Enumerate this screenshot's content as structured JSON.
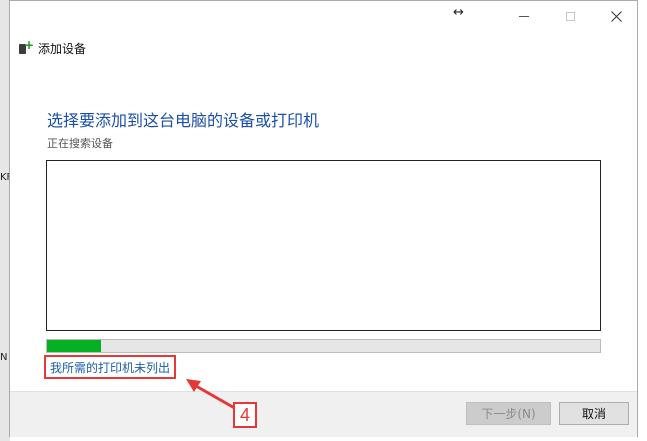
{
  "window": {
    "title": "添加设备"
  },
  "main": {
    "heading": "选择要添加到这台电脑的设备或打印机",
    "status": "正在搜索设备",
    "progress_fraction": 0.097
  },
  "link": {
    "printer_not_listed": "我所需的打印机未列出"
  },
  "annotation": {
    "step_number": "4",
    "color": "#e53935"
  },
  "footer": {
    "next_label": "下一步(N)",
    "cancel_label": "取消"
  },
  "background": {
    "fragments": [
      "KF",
      "N"
    ]
  },
  "icons": {
    "app": "add-device-icon",
    "resize": "resize-horizontal-icon",
    "minimize": "minimize-icon",
    "maximize": "maximize-icon",
    "close": "close-icon"
  },
  "colors": {
    "heading": "#1b4fa8",
    "link": "#1b5ea8",
    "progress": "#06b025"
  }
}
